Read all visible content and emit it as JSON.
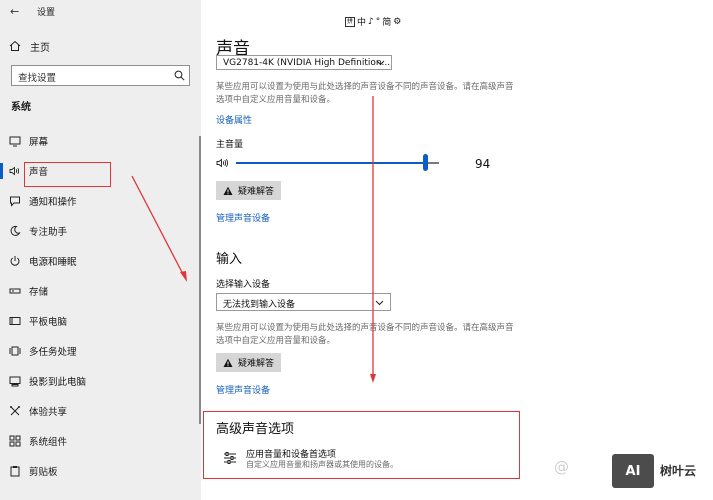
{
  "window": {
    "back_glyph": "←",
    "title": "设置"
  },
  "sidebar": {
    "home_label": "主页",
    "search_placeholder": "查找设置",
    "section": "系统",
    "items": [
      {
        "label": "屏幕",
        "icon": "monitor-icon"
      },
      {
        "label": "声音",
        "icon": "speaker-icon",
        "selected": true
      },
      {
        "label": "通知和操作",
        "icon": "notification-icon"
      },
      {
        "label": "专注助手",
        "icon": "moon-icon"
      },
      {
        "label": "电源和睡眠",
        "icon": "power-icon"
      },
      {
        "label": "存储",
        "icon": "storage-icon"
      },
      {
        "label": "平板电脑",
        "icon": "tablet-icon"
      },
      {
        "label": "多任务处理",
        "icon": "multitask-icon"
      },
      {
        "label": "投影到此电脑",
        "icon": "project-icon"
      },
      {
        "label": "体验共享",
        "icon": "share-icon"
      },
      {
        "label": "系统组件",
        "icon": "components-icon"
      },
      {
        "label": "剪贴板",
        "icon": "clipboard-icon"
      }
    ]
  },
  "ime_bar": {
    "text": [
      "中",
      "♪",
      "°",
      "简",
      "⚙"
    ],
    "box_glyph": "拼"
  },
  "main": {
    "title": "声音",
    "output_device": "VG2781-4K (NVIDIA High Definition...",
    "output_desc": "某些应用可以设置为使用与此处选择的声音设备不同的声音设备。请在高级声音选项中自定义应用音量和设备。",
    "device_props_link": "设备属性",
    "master_volume_label": "主音量",
    "master_volume_value": "94",
    "master_volume_level": 94,
    "troubleshoot_label": "疑难解答",
    "manage_devices_link": "管理声音设备",
    "input_heading": "输入",
    "input_select_label": "选择输入设备",
    "input_device": "无法找到输入设备",
    "input_desc": "某些应用可以设置为使用与此处选择的声音设备不同的声音设备。请在高级声音选项中自定义应用音量和设备。",
    "troubleshoot_label_2": "疑难解答",
    "manage_devices_link_2": "管理声音设备",
    "advanced_heading": "高级声音选项",
    "app_volume_label": "应用音量和设备首选项",
    "app_volume_desc": "自定义应用音量和扬声器或其使用的设备。"
  },
  "watermark": {
    "left_text": "@",
    "logo_text": "AI",
    "brand": "树叶云"
  },
  "colors": {
    "accent": "#0b5cc5",
    "highlight_box": "#e0353a",
    "sidebar_bg": "#eeeeee"
  }
}
